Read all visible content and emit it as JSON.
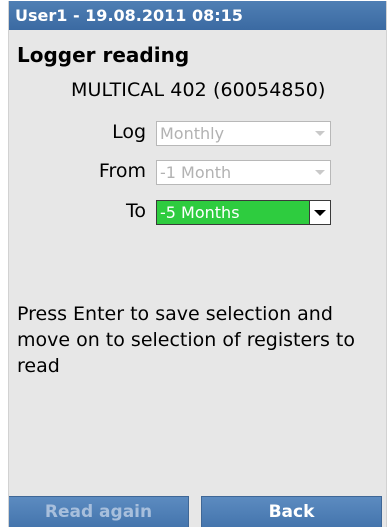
{
  "title_bar": {
    "text": "User1 - 19.08.2011 08:15"
  },
  "page": {
    "title": "Logger reading",
    "device": "MULTICAL 402  (60054850)"
  },
  "form": {
    "log": {
      "label": "Log",
      "value": "Monthly",
      "enabled": false
    },
    "from": {
      "label": "From",
      "value": "-1 Month",
      "enabled": false
    },
    "to": {
      "label": "To",
      "value": "-5 Months",
      "enabled": true,
      "highlight_color": "#2ecc3f"
    }
  },
  "instructions": "Press Enter to save selection and move on to selection of registers to read",
  "buttons": {
    "read_again": {
      "label": "Read again",
      "enabled": false
    },
    "back": {
      "label": "Back",
      "enabled": true
    }
  },
  "icons": {
    "dropdown": "chevron-down-icon"
  },
  "colors": {
    "title_bar": "#3b6aa2",
    "background": "#e7e7e7",
    "button": "#4475ad"
  }
}
